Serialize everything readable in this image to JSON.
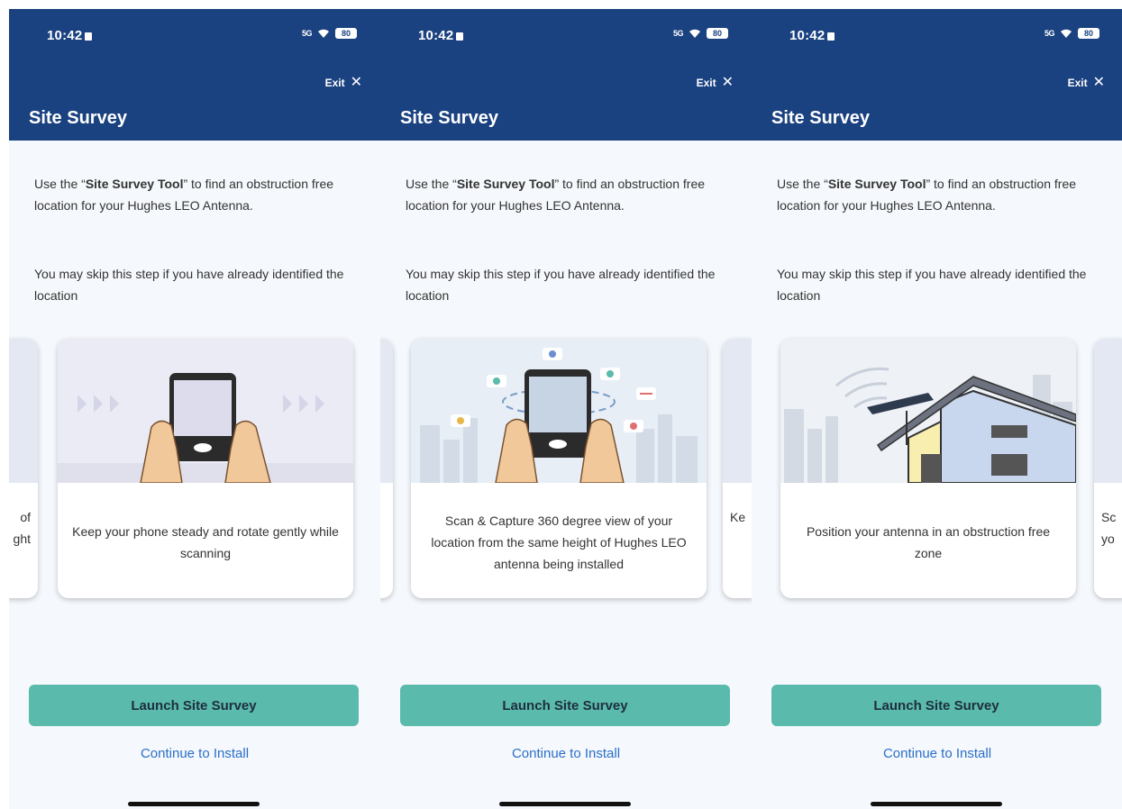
{
  "status_bar": {
    "time": "10:42",
    "signal": "5G",
    "battery": "80"
  },
  "header": {
    "exit_label": "Exit",
    "title": "Site Survey"
  },
  "intro": {
    "pre": "Use the “",
    "tool": "Site Survey Tool",
    "post": "” to find an obstruction free location for your Hughes LEO Antenna.",
    "skip": "You may skip this step if you have already identified the location"
  },
  "slides": [
    {
      "caption": "Keep your phone steady and rotate gently while scanning",
      "icon": "phone-steady-illustration"
    },
    {
      "caption": "Scan & Capture 360 degree view of your location from the same height of Hughes LEO antenna being installed",
      "icon": "phone-360-scan-illustration"
    },
    {
      "caption": "Position your antenna in an obstruction free zone",
      "icon": "antenna-house-illustration"
    }
  ],
  "panels": [
    {
      "left_frag": [
        "of",
        "ght"
      ],
      "right_frag": []
    },
    {
      "left_frag": [],
      "right_frag": [
        "Ke"
      ]
    },
    {
      "left_frag": [],
      "right_frag": [
        "Sc",
        "yo"
      ]
    }
  ],
  "actions": {
    "launch": "Launch Site Survey",
    "continue": "Continue to Install"
  },
  "colors": {
    "header": "#1a4180",
    "button": "#5abaab",
    "link": "#2a6fc8",
    "background": "#f5f8fc"
  }
}
